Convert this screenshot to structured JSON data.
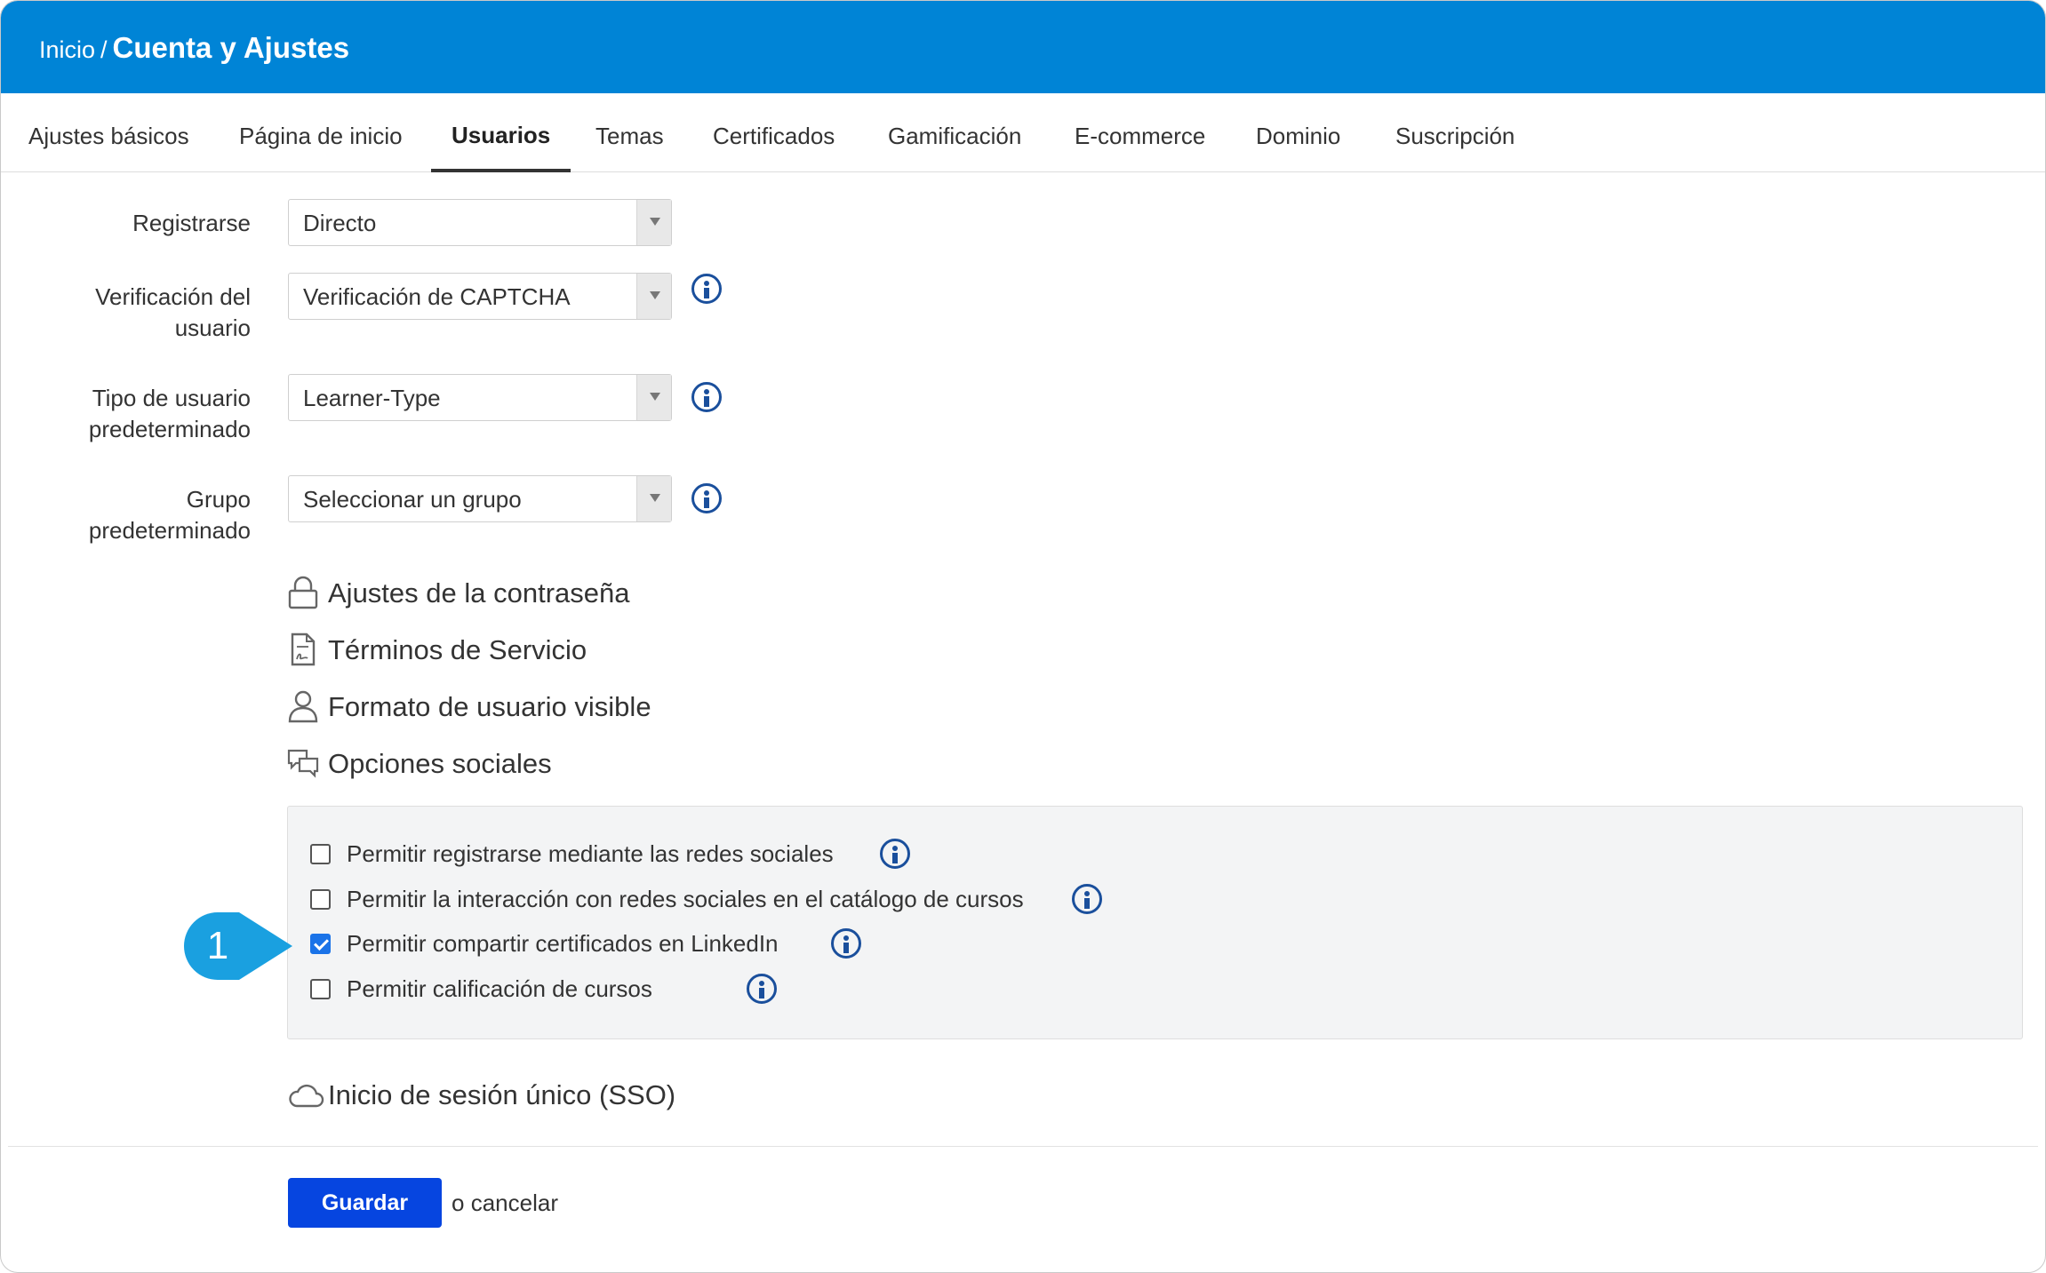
{
  "header": {
    "breadcrumb_home": "Inicio",
    "breadcrumb_separator": "/",
    "title": "Cuenta y Ajustes",
    "background_color": "#0084d6"
  },
  "tabs": [
    {
      "label": "Ajustes básicos",
      "active": false
    },
    {
      "label": "Página de inicio",
      "active": false
    },
    {
      "label": "Usuarios",
      "active": true
    },
    {
      "label": "Temas",
      "active": false
    },
    {
      "label": "Certificados",
      "active": false
    },
    {
      "label": "Gamificación",
      "active": false
    },
    {
      "label": "E-commerce",
      "active": false
    },
    {
      "label": "Dominio",
      "active": false
    },
    {
      "label": "Suscripción",
      "active": false
    }
  ],
  "form": {
    "signup": {
      "label": "Registrarse",
      "value": "Directo"
    },
    "verification": {
      "label_line1": "Verificación del",
      "label_line2": "usuario",
      "value": "Verificación de CAPTCHA"
    },
    "default_user_type": {
      "label_line1": "Tipo de usuario",
      "label_line2": "predeterminado",
      "value": "Learner-Type"
    },
    "default_group": {
      "label_line1": "Grupo",
      "label_line2": "predeterminado",
      "value": "Seleccionar un grupo"
    }
  },
  "sections": {
    "password": {
      "title": "Ajustes de la contraseña",
      "icon": "lock-icon"
    },
    "terms": {
      "title": "Términos de Servicio",
      "icon": "document-icon"
    },
    "user_format": {
      "title": "Formato de usuario visible",
      "icon": "user-icon"
    },
    "social": {
      "title": "Opciones sociales",
      "icon": "chat-bubbles-icon"
    },
    "sso": {
      "title": "Inicio de sesión único (SSO)",
      "icon": "cloud-icon"
    }
  },
  "social_options": [
    {
      "label": "Permitir registrarse mediante las redes sociales",
      "checked": false
    },
    {
      "label": "Permitir la interacción con redes sociales en el catálogo de cursos",
      "checked": false
    },
    {
      "label": "Permitir compartir certificados en LinkedIn",
      "checked": true
    },
    {
      "label": "Permitir calificación de cursos",
      "checked": false
    }
  ],
  "callout": {
    "number": "1",
    "color": "#1aa0e0"
  },
  "footer": {
    "save_label": "Guardar",
    "cancel_prefix": "o",
    "cancel_label": "cancelar",
    "save_color": "#0645e0"
  }
}
